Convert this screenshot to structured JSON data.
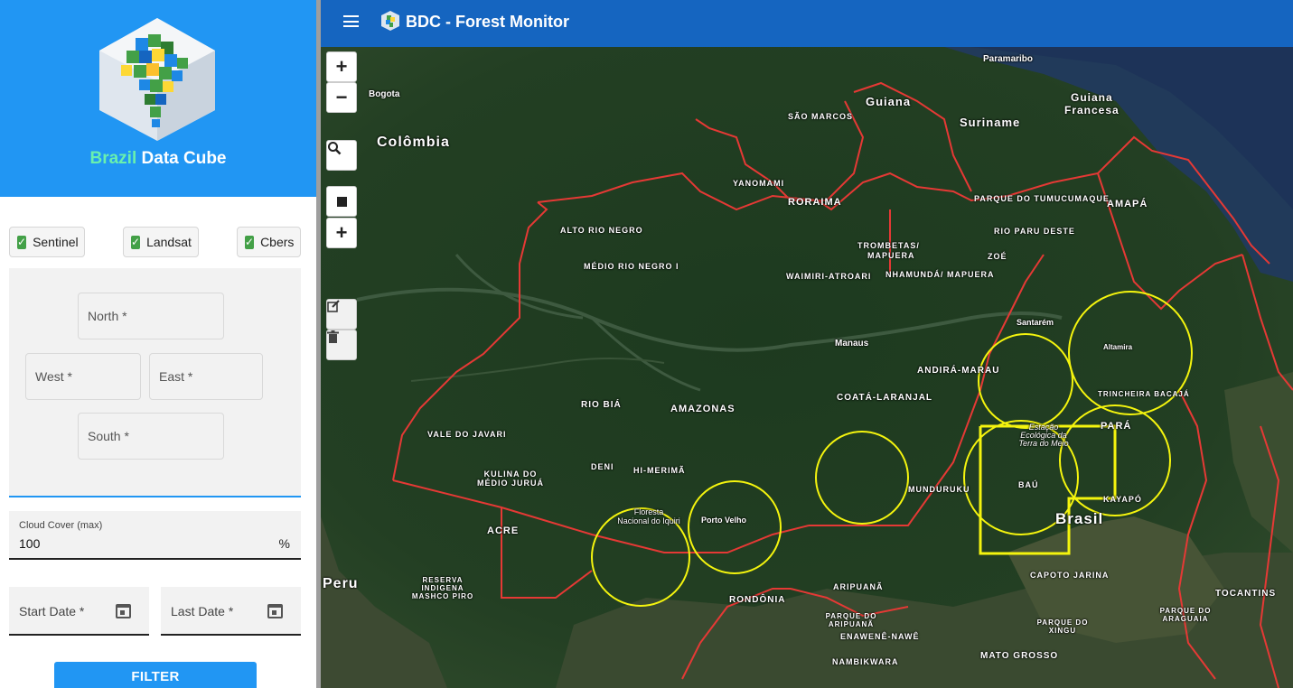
{
  "brand": {
    "name_part1": "Brazil",
    "name_part2": "Data Cube"
  },
  "satellites": [
    {
      "label": "Sentinel",
      "checked": true
    },
    {
      "label": "Landsat",
      "checked": true
    },
    {
      "label": "Cbers",
      "checked": true
    }
  ],
  "bbox": {
    "north": "North *",
    "west": "West *",
    "east": "East *",
    "south": "South *"
  },
  "cloud_cover": {
    "label": "Cloud Cover (max)",
    "value": "100",
    "unit": "%"
  },
  "dates": {
    "start": "Start Date *",
    "last": "Last Date *"
  },
  "filter_button": "FILTER",
  "app": {
    "title": "BDC - Forest Monitor"
  },
  "map_controls": {
    "zoom_in": "+",
    "zoom_out": "−",
    "add": "+"
  },
  "map_labels": {
    "colombia": "Colômbia",
    "guiana": "Guiana",
    "suriname": "Suriname",
    "guiana_francesa_1": "Guiana",
    "guiana_francesa_2": "Francesa",
    "roraima": "RORAIMA",
    "amapa": "AMAPÁ",
    "amazonas": "AMAZONAS",
    "para": "PARÁ",
    "brasil": "Brasil",
    "peru": "Peru",
    "acre": "ACRE",
    "rondonia": "RONDÔNIA",
    "tocantins": "TOCANTINS",
    "mato_grosso": "MATO GROSSO",
    "manaus": "Manaus",
    "bogota": "Bogota",
    "paramaribo": "Paramaribo",
    "sao_marcos": "SÃO MARCOS",
    "yanomami": "YANOMAMI",
    "trombetas": "TROMBETAS/",
    "mapuera": "MAPUERA",
    "tumucumaque": "PARQUE DO TUMUCUMAQUE",
    "rio_paru": "RIO PARU DESTE",
    "zoe": "ZOÉ",
    "alto_rio_negro": "ALTO RIO NEGRO",
    "medio_rio_negro": "MÉDIO RIO NEGRO I",
    "waimiri": "WAIMIRI-ATROARI",
    "nhamunda": "NHAMUNDÁ/ MAPUERA",
    "andira_marau": "ANDIRÁ-MARAU",
    "coata_laranjal": "COATÁ-LARANJAL",
    "rio_biá": "RIO BIÁ",
    "vale_do_javari": "VALE DO JAVARI",
    "deni": "DENI",
    "hi_merima": "HI-MERIMÃ",
    "kulina": "KULINA DO MÉDIO JURUÁ",
    "munduruku": "MUNDURUKU",
    "bau": "BAÚ",
    "kayapo": "KAYAPÓ",
    "trincheira": "TRINCHEIRA BACAJÁ",
    "capoto": "CAPOTO JARINA",
    "aripuana": "ARIPUANÃ",
    "enawene": "ENAWENÊ-NAWÊ",
    "nambikwara": "NAMBIKWARA",
    "parque_xingu": "PARQUE DO XINGU",
    "parque_araguaia": "PARQUE DO ARAGUAIA",
    "reserva_mashco": "RESERVA INDIGENA MASHCO PIRO",
    "parque_aripuana": "PARQUE DO ARIPUANÃ",
    "porto_velho": "Porto Velho",
    "santarem": "Santarém",
    "altamira": "Altamira",
    "terra_do_meio": "Estação Ecológica da Terra do Meio",
    "floresta_iquiri": "Floresta Nacional do Iquiri"
  },
  "colors": {
    "sidebar_header": "#2196f3",
    "appbar": "#1565c0",
    "accent_green": "#69f0ae",
    "checkbox": "#43a047",
    "aoi_circle": "#f4f40e",
    "boundary": "#e53935"
  }
}
